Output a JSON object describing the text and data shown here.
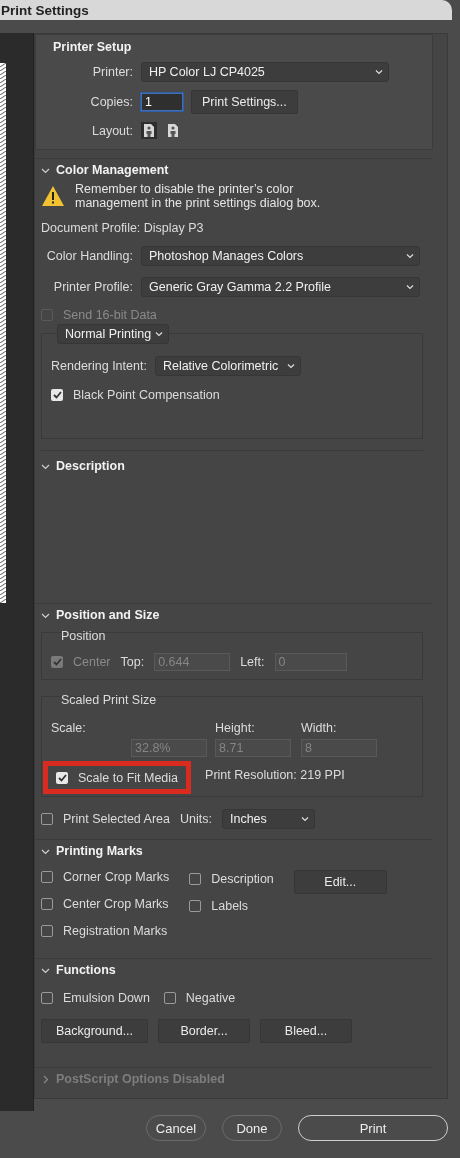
{
  "window": {
    "title": "Print Settings"
  },
  "printer_setup": {
    "title": "Printer Setup",
    "printer": {
      "label": "Printer:",
      "value": "HP Color LJ CP4025"
    },
    "copies": {
      "label": "Copies:",
      "value": "1"
    },
    "print_settings_button": "Print Settings...",
    "layout": {
      "label": "Layout:",
      "options": [
        {
          "selected": true
        },
        {
          "selected": false
        }
      ]
    }
  },
  "color_management": {
    "title": "Color Management",
    "expanded": true,
    "warning": "Remember to disable the printer’s color management in the print settings dialog box.",
    "document_profile": "Document Profile: Display P3",
    "color_handling": {
      "label": "Color Handling:",
      "value": "Photoshop Manages Colors"
    },
    "printer_profile": {
      "label": "Printer Profile:",
      "value": "Generic Gray Gamma 2.2 Profile"
    },
    "send_16bit": {
      "label": "Send 16-bit Data",
      "checked": false,
      "disabled": true
    },
    "mode": "Normal Printing",
    "rendering_intent": {
      "label": "Rendering Intent:",
      "value": "Relative Colorimetric"
    },
    "black_point": {
      "label": "Black Point Compensation",
      "checked": true,
      "disabled": false
    }
  },
  "description": {
    "title": "Description",
    "expanded": true
  },
  "position_and_size": {
    "title": "Position and Size",
    "expanded": true,
    "position": {
      "title": "Position",
      "center": {
        "label": "Center",
        "checked": true,
        "disabled": true
      },
      "top": {
        "label": "Top:",
        "value": "0.644",
        "disabled": true
      },
      "left": {
        "label": "Left:",
        "value": "0",
        "disabled": true
      }
    },
    "scaled": {
      "title": "Scaled Print Size",
      "scale": {
        "label": "Scale:",
        "value": "32.8%",
        "disabled": true
      },
      "height": {
        "label": "Height:",
        "value": "8.71",
        "disabled": true
      },
      "width": {
        "label": "Width:",
        "value": "8",
        "disabled": true
      },
      "scale_to_fit": {
        "label": "Scale to Fit Media",
        "checked": true,
        "disabled": false,
        "highlighted": true
      },
      "resolution": "Print Resolution: 219 PPI"
    },
    "print_selected": {
      "label": "Print Selected Area",
      "checked": false,
      "disabled": false
    },
    "units": {
      "label": "Units:",
      "value": "Inches"
    }
  },
  "printing_marks": {
    "title": "Printing Marks",
    "expanded": true,
    "columns": [
      [
        {
          "label": "Corner Crop Marks",
          "checked": false,
          "disabled": false
        },
        {
          "label": "Center Crop Marks",
          "checked": false,
          "disabled": false
        },
        {
          "label": "Registration Marks",
          "checked": false,
          "disabled": false
        }
      ],
      [
        {
          "label": "Description",
          "checked": false,
          "disabled": false
        },
        {
          "label": "Labels",
          "checked": false,
          "disabled": false
        }
      ]
    ],
    "edit_button": "Edit..."
  },
  "functions": {
    "title": "Functions",
    "expanded": true,
    "checkboxes": [
      {
        "label": "Emulsion Down",
        "checked": false,
        "disabled": false
      },
      {
        "label": "Negative",
        "checked": false,
        "disabled": false
      }
    ],
    "buttons": [
      "Background...",
      "Border...",
      "Bleed..."
    ]
  },
  "postscript": {
    "title": "PostScript Options Disabled",
    "expanded": false,
    "disabled": true
  },
  "buttons": [
    {
      "label": "Cancel",
      "kind": "secondary"
    },
    {
      "label": "Done",
      "kind": "secondary"
    },
    {
      "label": "Print",
      "kind": "primary"
    }
  ]
}
